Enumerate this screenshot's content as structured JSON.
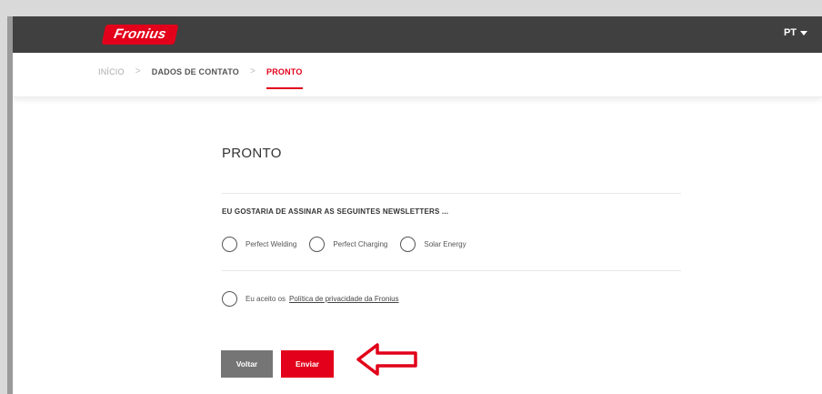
{
  "header": {
    "logo_text": "Fronius",
    "language": "PT"
  },
  "breadcrumb": {
    "items": [
      "INÍCIO",
      "DADOS DE CONTATO",
      "PRONTO"
    ],
    "separator": ">"
  },
  "main": {
    "title": "PRONTO",
    "newsletter_label": "EU GOSTARIA DE ASSINAR AS SEGUINTES NEWSLETTERS ...",
    "newsletters": [
      "Perfect Welding",
      "Perfect Charging",
      "Solar Energy"
    ],
    "privacy_prefix": "Eu aceito os",
    "privacy_link": "Política de privacidade da Fronius",
    "back_button": "Voltar",
    "submit_button": "Enviar"
  },
  "colors": {
    "brand_red": "#e2001a",
    "topbar": "#404040",
    "back_button": "#757575"
  },
  "icons": {
    "lang_caret": "chevron-down-icon",
    "annotation": "arrow-left-outline-icon"
  }
}
